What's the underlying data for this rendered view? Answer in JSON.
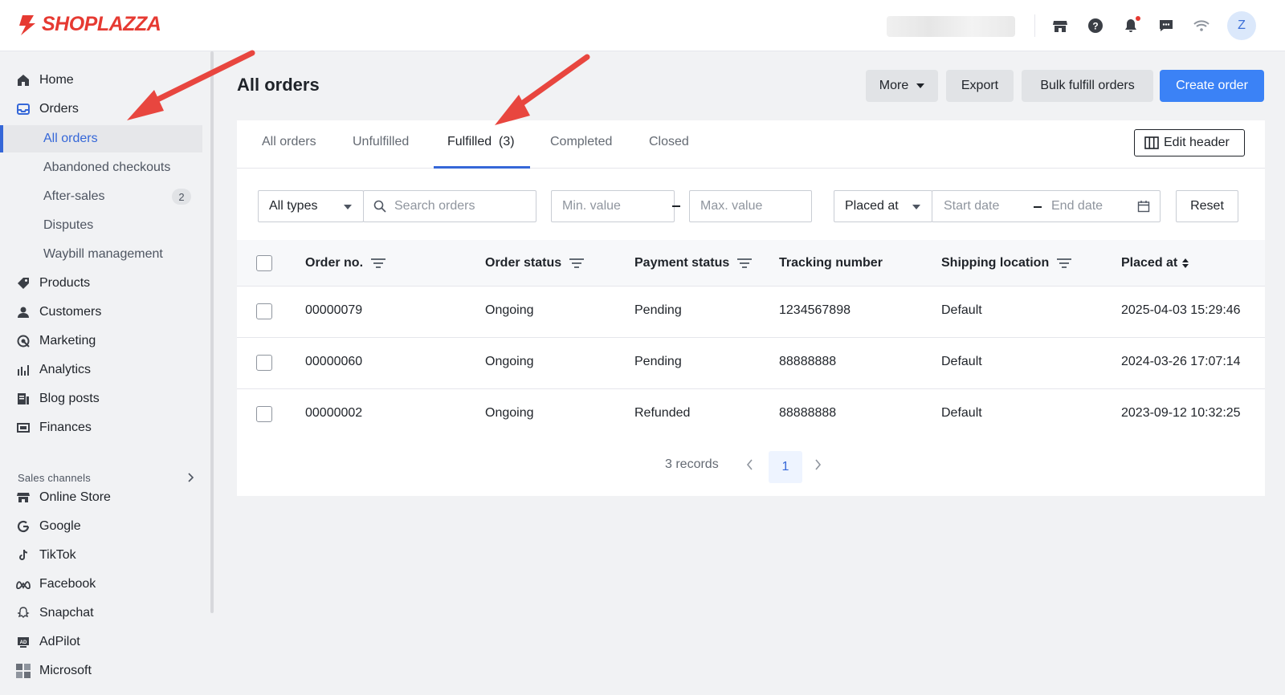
{
  "brand": {
    "name": "SHOPLAZZA",
    "color": "#e63a32"
  },
  "header": {
    "icons": [
      "store-icon",
      "help-icon",
      "bell-icon",
      "chat-icon",
      "wifi-icon"
    ],
    "avatar_initial": "Z"
  },
  "sidebar": {
    "items": [
      {
        "label": "Home",
        "icon": "home-icon"
      },
      {
        "label": "Orders",
        "icon": "orders-icon"
      },
      {
        "label": "Products",
        "icon": "tag-icon"
      },
      {
        "label": "Customers",
        "icon": "person-icon"
      },
      {
        "label": "Marketing",
        "icon": "marketing-icon"
      },
      {
        "label": "Analytics",
        "icon": "bar-chart-icon"
      },
      {
        "label": "Blog posts",
        "icon": "blog-icon"
      },
      {
        "label": "Finances",
        "icon": "finance-icon"
      }
    ],
    "order_subitems": [
      {
        "label": "All orders",
        "active": true
      },
      {
        "label": "Abandoned checkouts"
      },
      {
        "label": "After-sales",
        "badge": "2"
      },
      {
        "label": "Disputes"
      },
      {
        "label": "Waybill management"
      }
    ],
    "sales_channels_label": "Sales channels",
    "channels": [
      {
        "label": "Online Store",
        "icon": "store-icon"
      },
      {
        "label": "Google",
        "icon": "google-icon"
      },
      {
        "label": "TikTok",
        "icon": "tiktok-icon"
      },
      {
        "label": "Facebook",
        "icon": "meta-icon"
      },
      {
        "label": "Snapchat",
        "icon": "snapchat-icon"
      },
      {
        "label": "AdPilot",
        "icon": "adpilot-icon"
      },
      {
        "label": "Microsoft",
        "icon": "microsoft-icon"
      }
    ]
  },
  "main": {
    "title": "All orders",
    "actions": {
      "more": "More",
      "export": "Export",
      "bulk": "Bulk fulfill orders",
      "create": "Create order"
    },
    "tabs": [
      {
        "label": "All orders"
      },
      {
        "label": "Unfulfilled"
      },
      {
        "label": "Fulfilled  (3)",
        "active": true
      },
      {
        "label": "Completed"
      },
      {
        "label": "Closed"
      }
    ],
    "edit_header": "Edit header",
    "filters": {
      "type_value": "All types",
      "search_placeholder": "Search orders",
      "min_placeholder": "Min. value",
      "max_placeholder": "Max. value",
      "date_field": "Placed at",
      "start_placeholder": "Start date",
      "end_placeholder": "End date",
      "reset": "Reset"
    },
    "columns": [
      "Order no.",
      "Order status",
      "Payment status",
      "Tracking number",
      "Shipping location",
      "Placed at"
    ],
    "rows": [
      {
        "order_no": "00000079",
        "order_status": "Ongoing",
        "payment_status": "Pending",
        "tracking": "1234567898",
        "location": "Default",
        "placed_at": "2025-04-03 15:29:46"
      },
      {
        "order_no": "00000060",
        "order_status": "Ongoing",
        "payment_status": "Pending",
        "tracking": "88888888",
        "location": "Default",
        "placed_at": "2024-03-26 17:07:14"
      },
      {
        "order_no": "00000002",
        "order_status": "Ongoing",
        "payment_status": "Refunded",
        "tracking": "88888888",
        "location": "Default",
        "placed_at": "2023-09-12 10:32:25"
      }
    ],
    "pagination": {
      "records": "3 records",
      "current_page": "1"
    }
  },
  "accent_colors": {
    "primary": "#3b82f6",
    "active_link": "#3567d8",
    "annotation_arrow": "#e8463f"
  }
}
